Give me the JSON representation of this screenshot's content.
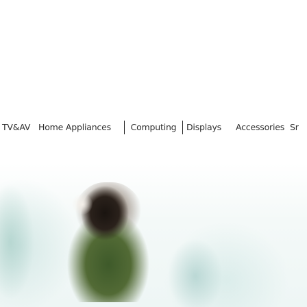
{
  "category_nav": {
    "items": [
      {
        "label": "TV&AV"
      },
      {
        "label": "Home Appliances"
      },
      {
        "label": "Computing",
        "selected": true
      },
      {
        "label": "Displays"
      },
      {
        "label": "Accessories"
      },
      {
        "label": "Sr"
      }
    ]
  },
  "colors": {
    "nav_text": "#2f2f2f",
    "selected_border": "#222222",
    "hero_tint": "#bfe0dc"
  }
}
